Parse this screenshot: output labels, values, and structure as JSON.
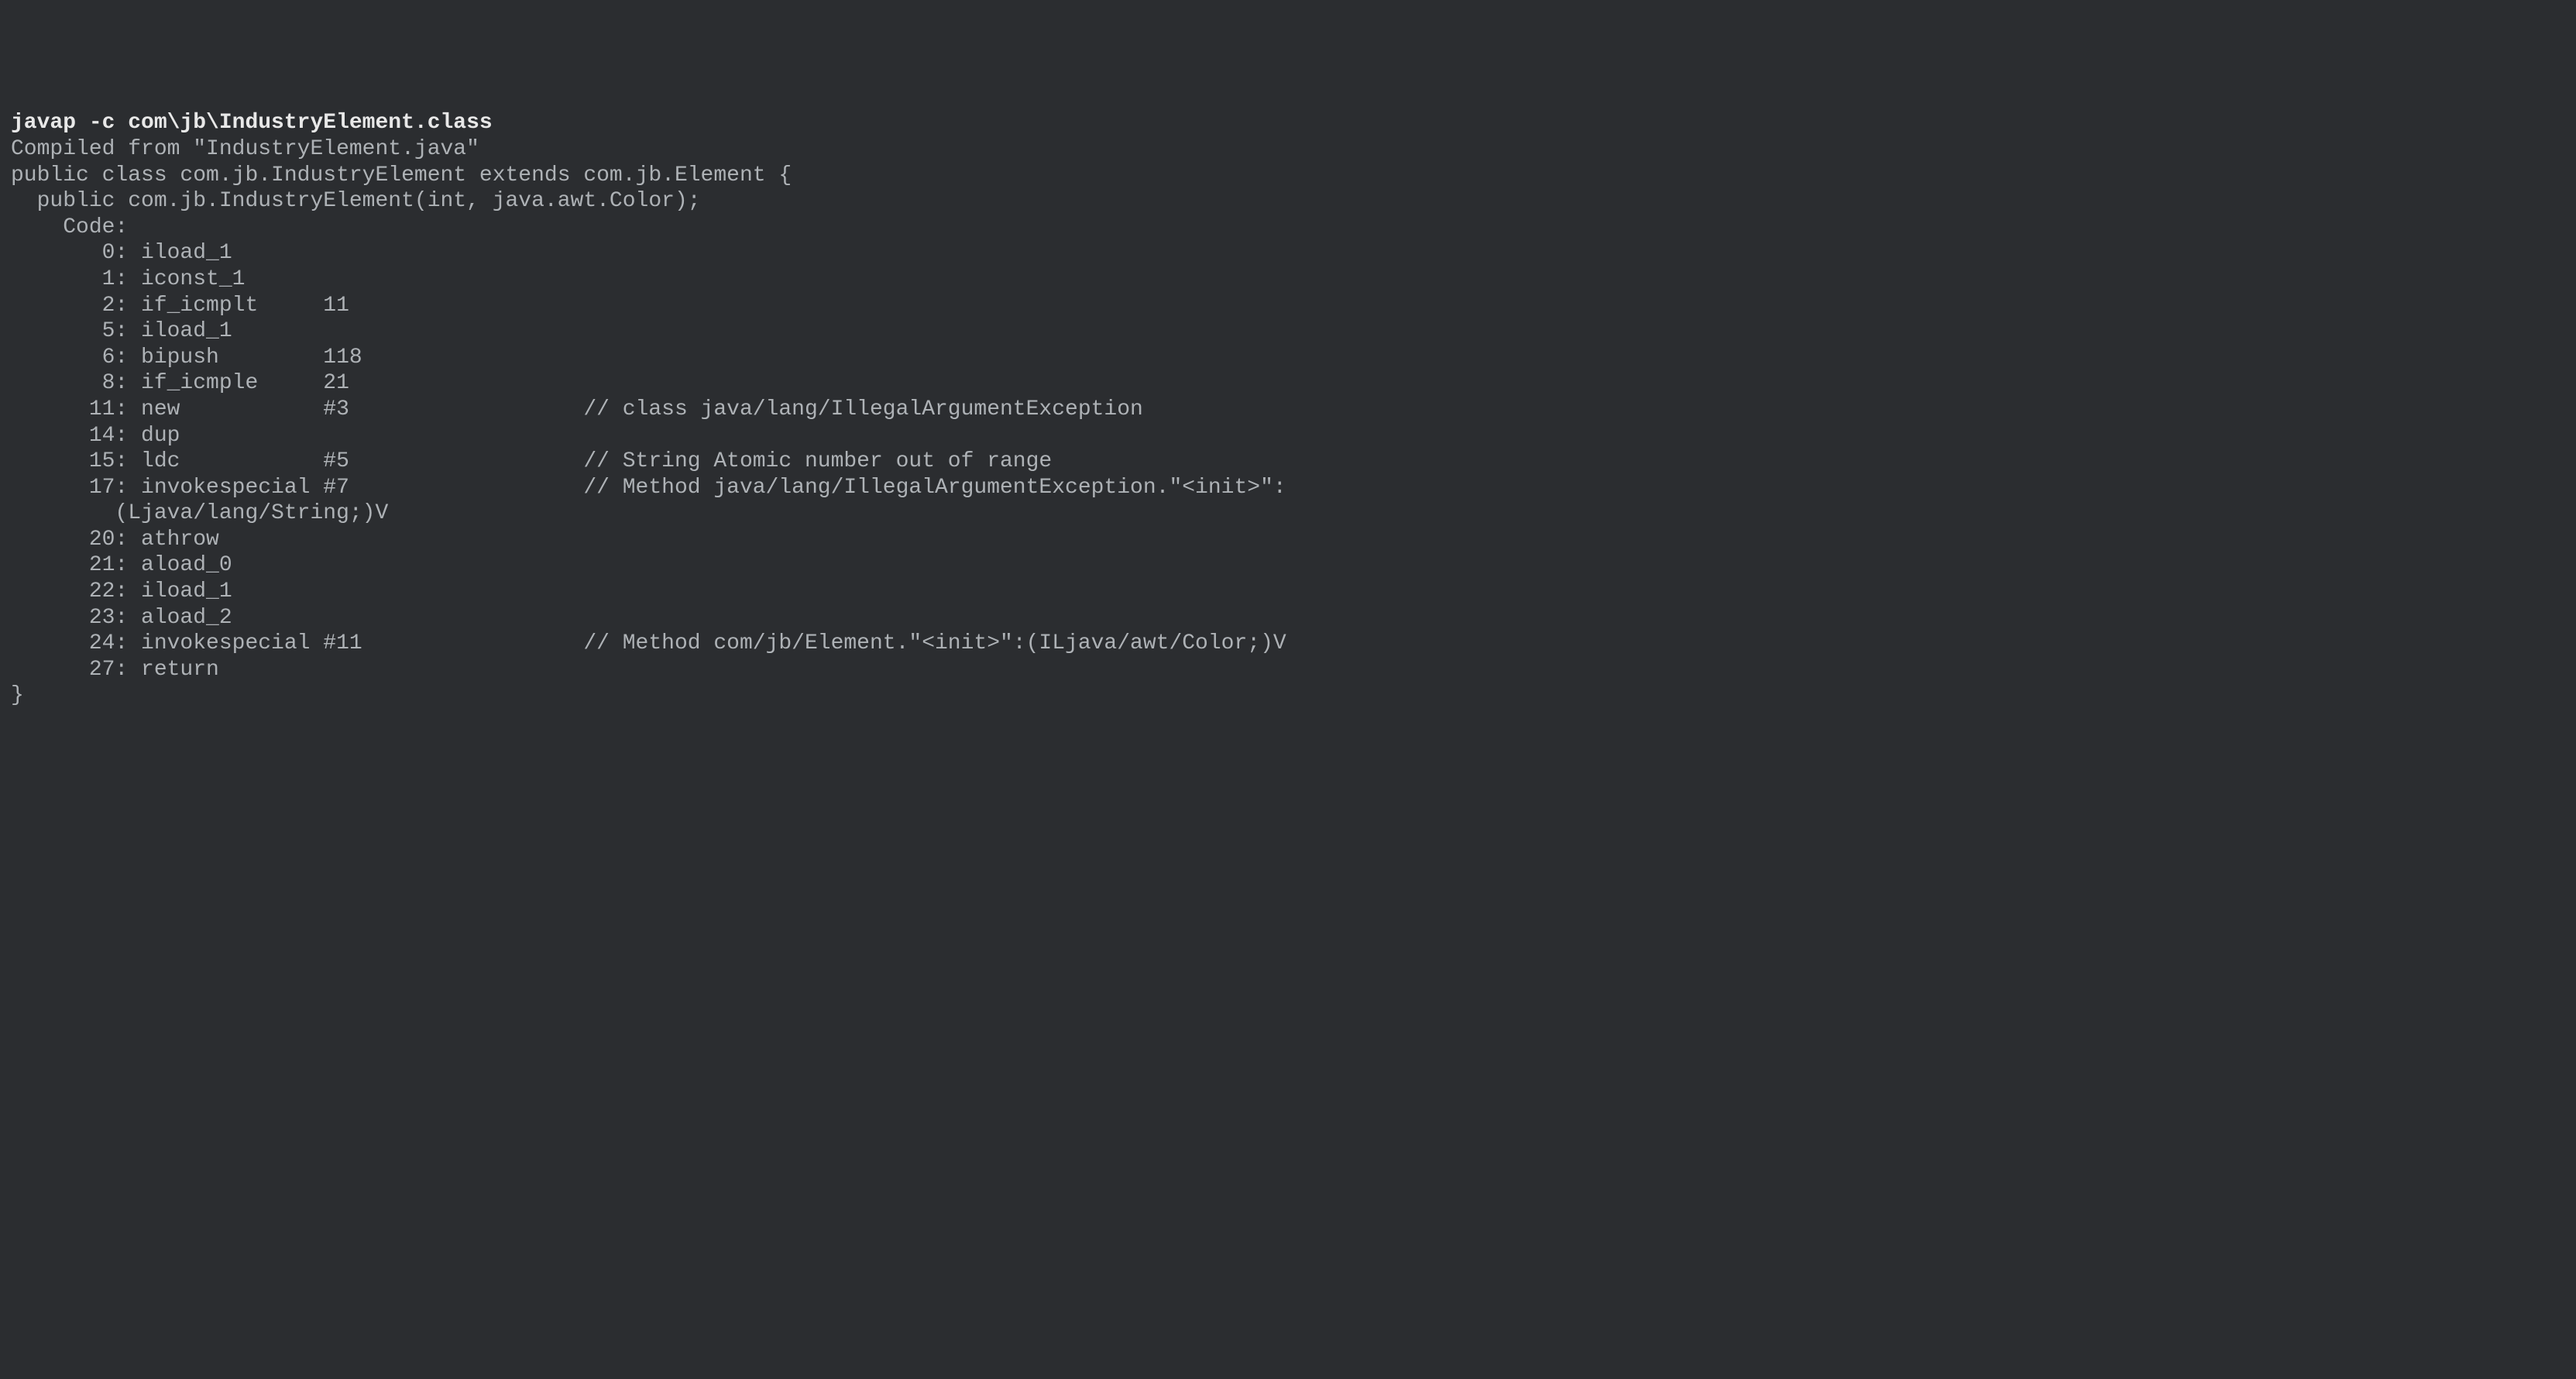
{
  "command": "javap -c com\\jb\\IndustryElement.class",
  "output_lines": [
    "Compiled from \"IndustryElement.java\"",
    "public class com.jb.IndustryElement extends com.jb.Element {",
    "  public com.jb.IndustryElement(int, java.awt.Color);",
    "    Code:",
    "       0: iload_1",
    "       1: iconst_1",
    "       2: if_icmplt     11",
    "       5: iload_1",
    "       6: bipush        118",
    "       8: if_icmple     21",
    "      11: new           #3                  // class java/lang/IllegalArgumentException",
    "      14: dup",
    "      15: ldc           #5                  // String Atomic number out of range",
    "      17: invokespecial #7                  // Method java/lang/IllegalArgumentException.\"<init>\":",
    "        (Ljava/lang/String;)V",
    "      20: athrow",
    "      21: aload_0",
    "      22: iload_1",
    "      23: aload_2",
    "      24: invokespecial #11                 // Method com/jb/Element.\"<init>\":(ILjava/awt/Color;)V",
    "      27: return",
    "}"
  ]
}
